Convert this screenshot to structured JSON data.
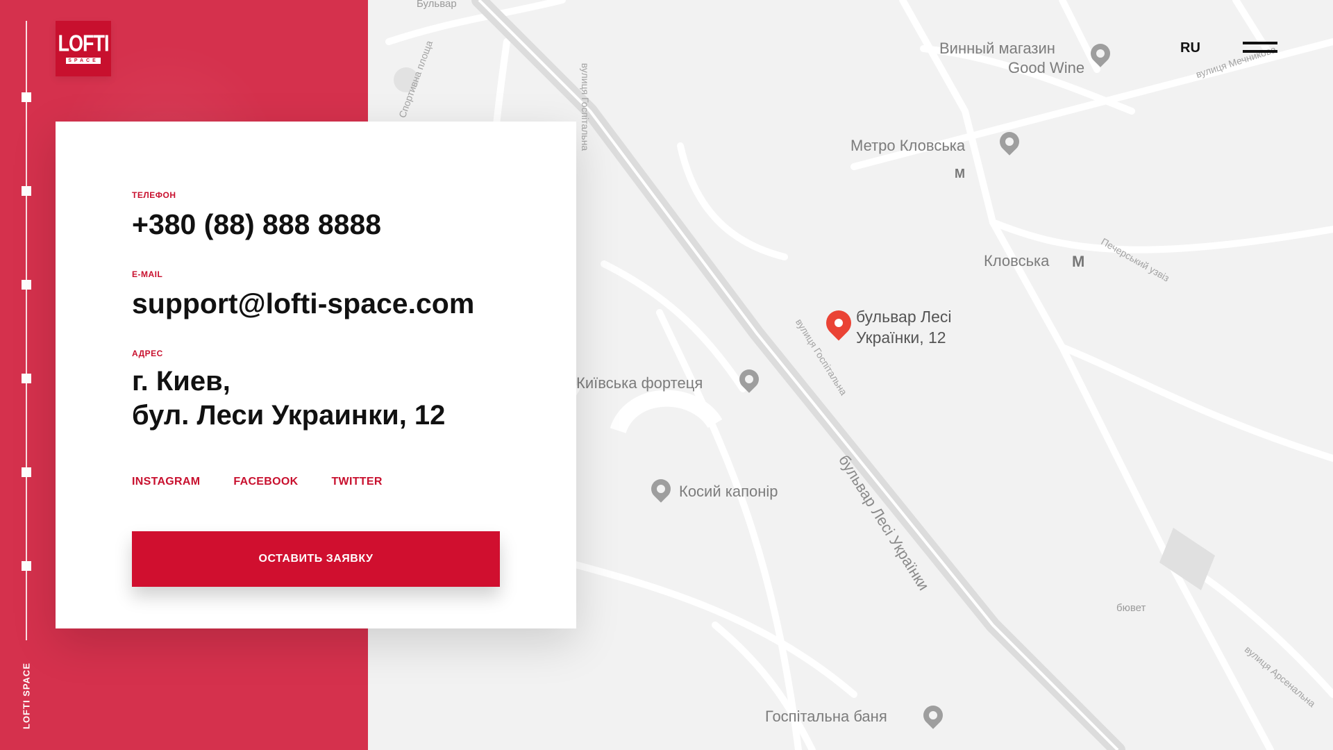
{
  "brand": {
    "logo_main": "LOFTI",
    "logo_sub": "SPACE",
    "vertical_text": "LOFTI SPACE",
    "color": "#d5314d"
  },
  "header": {
    "language": "RU",
    "menu_icon": "hamburger-icon"
  },
  "contacts": {
    "phone_label": "ТЕЛЕФОН",
    "phone_value": "+380 (88) 888 8888",
    "email_label": "E-MAIL",
    "email_value": "support@lofti-space.com",
    "address_label": "АДРЕС",
    "address_line1": "г. Киев,",
    "address_line2": "бул. Леси Украинки, 12",
    "socials": [
      "INSTAGRAM",
      "FACEBOOK",
      "TWITTER"
    ],
    "cta_label": "ОСТАВИТЬ ЗАЯВКУ"
  },
  "map": {
    "labels": {
      "wine_shop_line1": "Винный магазин",
      "wine_shop_line2": "Good Wine",
      "metro_klovska": "Метро Кловська",
      "klovska": "Кловська",
      "marker_line1": "бульвар Лесі",
      "marker_line2": "Українки, 12",
      "fortress": "Київська фортеця",
      "caponier": "Косий капонір",
      "bath": "Госпітальна баня",
      "bjuvet": "бювет",
      "boulevard_road": "бульвар Лесі Українки",
      "street_hospitalna": "вулиця Госпітальна",
      "street_pecherskyi": "Печерський узвіз",
      "street_arsenalna": "вулиця Арсенальна",
      "street_top": "вулиця Мечникова",
      "sport_square": "Спортивна площа",
      "boulevard_top": "Бульвар",
      "street_left": "вулиця Госпітальна"
    },
    "accent_marker_color": "#ea4335"
  },
  "colors": {
    "accent": "#c8102e",
    "map_bg": "#f2f2f2"
  }
}
